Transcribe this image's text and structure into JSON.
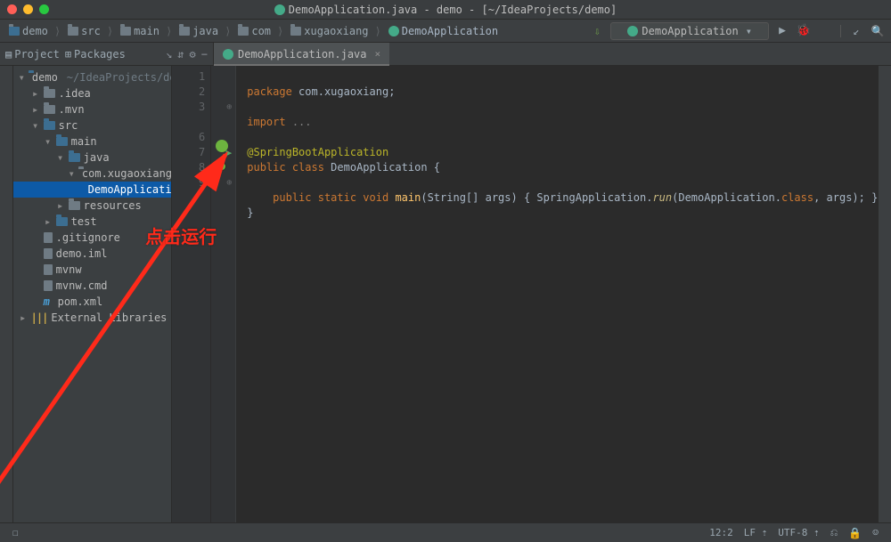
{
  "titlebar": {
    "title": "DemoApplication.java - demo - [~/IdeaProjects/demo]"
  },
  "breadcrumbs": [
    {
      "label": "demo",
      "type": "proj"
    },
    {
      "label": "src",
      "type": "dir"
    },
    {
      "label": "main",
      "type": "dir"
    },
    {
      "label": "java",
      "type": "dir"
    },
    {
      "label": "com",
      "type": "dir"
    },
    {
      "label": "xugaoxiang",
      "type": "dir"
    },
    {
      "label": "DemoApplication",
      "type": "cls"
    }
  ],
  "run_config": {
    "label": "DemoApplication"
  },
  "tool_tabs": {
    "project": "Project",
    "packages": "Packages"
  },
  "editor_tab": {
    "label": "DemoApplication.java"
  },
  "tree": {
    "root": {
      "name": "demo",
      "path": "~/IdeaProjects/demo"
    },
    "nodes": [
      {
        "indent": 1,
        "arrow": "▸",
        "icon": "folder",
        "name": ".idea"
      },
      {
        "indent": 1,
        "arrow": "▸",
        "icon": "folder",
        "name": ".mvn"
      },
      {
        "indent": 1,
        "arrow": "▾",
        "icon": "folder-blue",
        "name": "src"
      },
      {
        "indent": 2,
        "arrow": "▾",
        "icon": "folder-blue",
        "name": "main"
      },
      {
        "indent": 3,
        "arrow": "▾",
        "icon": "folder-blue",
        "name": "java"
      },
      {
        "indent": 4,
        "arrow": "▾",
        "icon": "folder-pkg",
        "name": "com.xugaoxiang"
      },
      {
        "indent": 5,
        "arrow": "",
        "icon": "class",
        "name": "DemoApplication",
        "sel": true
      },
      {
        "indent": 3,
        "arrow": "▸",
        "icon": "folder",
        "name": "resources"
      },
      {
        "indent": 2,
        "arrow": "▸",
        "icon": "folder-blue",
        "name": "test"
      },
      {
        "indent": 1,
        "arrow": "",
        "icon": "file",
        "name": ".gitignore"
      },
      {
        "indent": 1,
        "arrow": "",
        "icon": "file",
        "name": "demo.iml"
      },
      {
        "indent": 1,
        "arrow": "",
        "icon": "file",
        "name": "mvnw"
      },
      {
        "indent": 1,
        "arrow": "",
        "icon": "file",
        "name": "mvnw.cmd"
      },
      {
        "indent": 1,
        "arrow": "",
        "icon": "pom",
        "name": "pom.xml"
      }
    ],
    "ext_lib": "External Libraries"
  },
  "gutter": {
    "lines": [
      "1",
      "2",
      "3",
      "",
      "6",
      "7",
      "8",
      "9",
      ""
    ]
  },
  "code": {
    "l1_kw": "package",
    "l1_pkg": " com.xugaoxiang;",
    "l3_kw": "import",
    "l3_rest": " ...",
    "l6": "@SpringBootApplication",
    "l7_kw1": "public class ",
    "l7_cls": "DemoApplication",
    "l7_brace": " {",
    "l9_pre": "    ",
    "l9_kw": "public static void ",
    "l9_fn": "main",
    "l9_sig": "(String[] args) { SpringApplication.",
    "l9_run": "run",
    "l9_rest": "(DemoApplication.",
    "l9_class": "class",
    "l9_end": ", args); }",
    "l10": "}"
  },
  "annotation": {
    "text": "点击运行"
  },
  "status": {
    "pos": "12:2",
    "le": "LF",
    "enc": "UTF-8"
  }
}
